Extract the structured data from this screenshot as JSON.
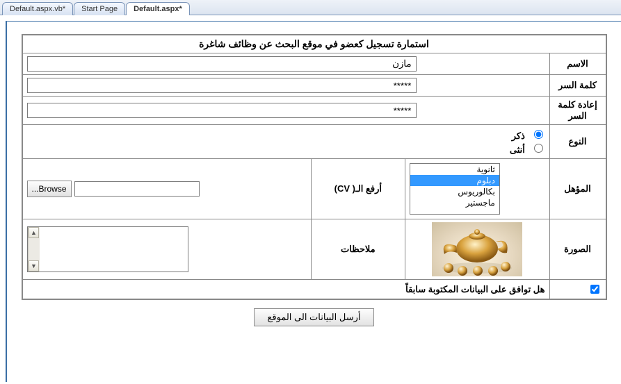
{
  "tabs": {
    "t0": "Default.aspx.vb*",
    "t1": "Start Page",
    "t2": "Default.aspx*"
  },
  "form": {
    "title": "استمارة تسجيل كعضو في موقع  البحث عن وظائف شاغرة",
    "labels": {
      "name": "الاسم",
      "password": "كلمة السر",
      "repassword": "إعادة كلمة السر",
      "gender": "النوع",
      "qualification": "المؤهل",
      "cv": "أرفع الـ( CV)",
      "image": "الصورة",
      "notes": "ملاحظات",
      "agree": "هل توافق على البيانات المكتوبة سابقاً"
    },
    "values": {
      "name": "مازن",
      "password": "*****",
      "repassword": "*****"
    },
    "gender": {
      "male": "ذكر",
      "female": "أنثى"
    },
    "qualifications": {
      "opt0": "ثانوية",
      "opt1": "دبلوم",
      "opt2": "بكالوريوس",
      "opt3": "ماجستير"
    },
    "browse_btn": "...Browse",
    "submit_btn": "أرسل البيانات الى الموقع"
  }
}
